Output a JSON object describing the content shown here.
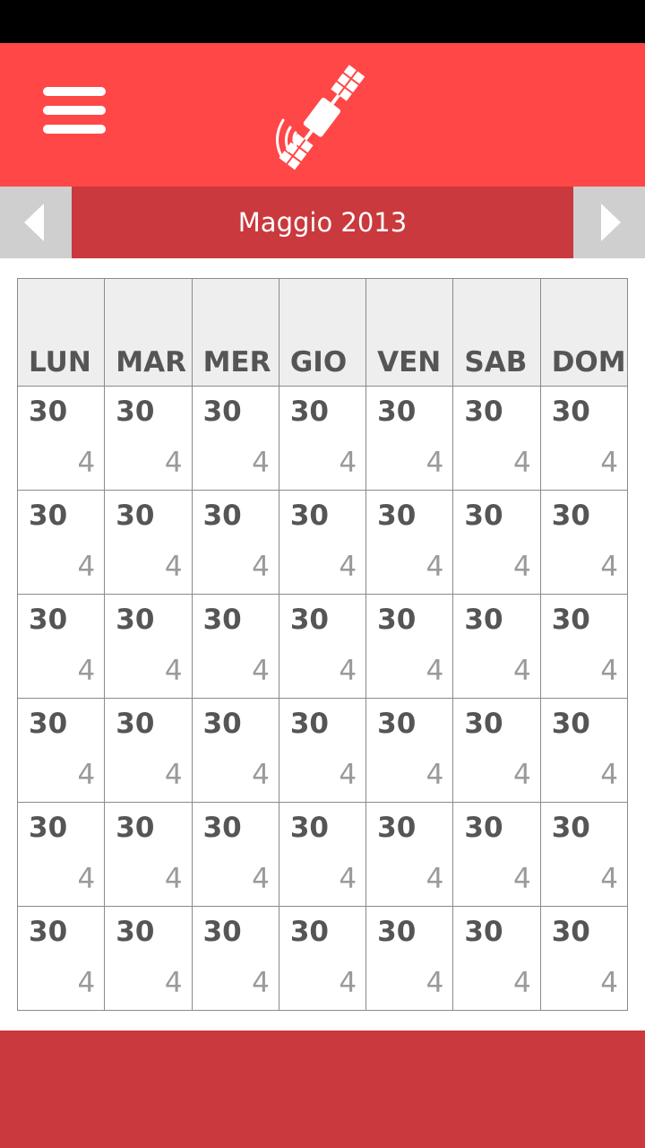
{
  "colors": {
    "app_bar": "#ff4747",
    "month_title_bg": "#c9393d",
    "nav_button_bg": "#cfcfcf",
    "header_cell_bg": "#eeeeee",
    "footer_bg": "#c9393d"
  },
  "app_bar": {
    "menu_icon": "hamburger-menu-icon",
    "logo_icon": "satellite-icon"
  },
  "month_nav": {
    "title": "Maggio 2013",
    "prev_icon": "chevron-left-icon",
    "next_icon": "chevron-right-icon"
  },
  "calendar": {
    "weekdays": [
      "LUN",
      "MAR",
      "MER",
      "GIO",
      "VEN",
      "SAB",
      "DOM"
    ],
    "weeks": [
      [
        {
          "day": "30",
          "count": "4"
        },
        {
          "day": "30",
          "count": "4"
        },
        {
          "day": "30",
          "count": "4"
        },
        {
          "day": "30",
          "count": "4"
        },
        {
          "day": "30",
          "count": "4"
        },
        {
          "day": "30",
          "count": "4"
        },
        {
          "day": "30",
          "count": "4"
        }
      ],
      [
        {
          "day": "30",
          "count": "4"
        },
        {
          "day": "30",
          "count": "4"
        },
        {
          "day": "30",
          "count": "4"
        },
        {
          "day": "30",
          "count": "4"
        },
        {
          "day": "30",
          "count": "4"
        },
        {
          "day": "30",
          "count": "4"
        },
        {
          "day": "30",
          "count": "4"
        }
      ],
      [
        {
          "day": "30",
          "count": "4"
        },
        {
          "day": "30",
          "count": "4"
        },
        {
          "day": "30",
          "count": "4"
        },
        {
          "day": "30",
          "count": "4"
        },
        {
          "day": "30",
          "count": "4"
        },
        {
          "day": "30",
          "count": "4"
        },
        {
          "day": "30",
          "count": "4"
        }
      ],
      [
        {
          "day": "30",
          "count": "4"
        },
        {
          "day": "30",
          "count": "4"
        },
        {
          "day": "30",
          "count": "4"
        },
        {
          "day": "30",
          "count": "4"
        },
        {
          "day": "30",
          "count": "4"
        },
        {
          "day": "30",
          "count": "4"
        },
        {
          "day": "30",
          "count": "4"
        }
      ],
      [
        {
          "day": "30",
          "count": "4"
        },
        {
          "day": "30",
          "count": "4"
        },
        {
          "day": "30",
          "count": "4"
        },
        {
          "day": "30",
          "count": "4"
        },
        {
          "day": "30",
          "count": "4"
        },
        {
          "day": "30",
          "count": "4"
        },
        {
          "day": "30",
          "count": "4"
        }
      ],
      [
        {
          "day": "30",
          "count": "4"
        },
        {
          "day": "30",
          "count": "4"
        },
        {
          "day": "30",
          "count": "4"
        },
        {
          "day": "30",
          "count": "4"
        },
        {
          "day": "30",
          "count": "4"
        },
        {
          "day": "30",
          "count": "4"
        },
        {
          "day": "30",
          "count": "4"
        }
      ]
    ]
  }
}
